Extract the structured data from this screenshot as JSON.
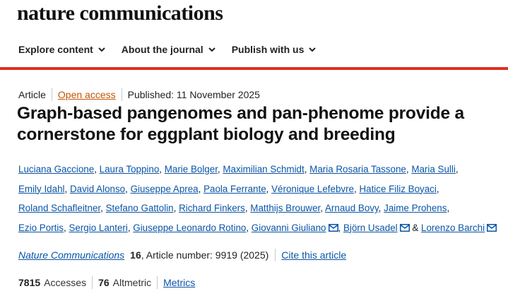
{
  "brand": "nature communications",
  "nav": [
    {
      "label": "Explore content"
    },
    {
      "label": "About the journal"
    },
    {
      "label": "Publish with us"
    }
  ],
  "meta": {
    "type": "Article",
    "access": "Open access",
    "published": "Published: 11 November 2025"
  },
  "title": "Graph-based pangenomes and pan-phenome provide a cornerstone for eggplant biology and breeding",
  "authors": [
    "Luciana Gaccione",
    "Laura Toppino",
    "Marie Bolger",
    "Maximilian Schmidt",
    "Maria Rosaria Tassone",
    "Maria Sulli",
    "Emily Idahl",
    "David Alonso",
    "Giuseppe Aprea",
    "Paola Ferrante",
    "Véronique Lefebvre",
    "Hatice Filiz Boyaci",
    "Roland Schafleitner",
    "Stefano Gattolin",
    "Richard Finkers",
    "Matthijs Brouwer",
    "Arnaud Bovy",
    "Jaime Prohens",
    "Ezio Portis",
    "Sergio Lanteri",
    "Giuseppe Leonardo Rotino",
    "Giovanni Giuliano",
    "Björn Usadel",
    "Lorenzo Barchi"
  ],
  "authors_and": "&",
  "citation": {
    "journal": "Nature Communications",
    "details": "16, Article number: 9919 (2025)",
    "volume": "16",
    "article_number": ", Article number: 9919 (2025)",
    "cite_link": "Cite this article"
  },
  "metrics": {
    "accesses_count": "7815",
    "accesses_label": "Accesses",
    "altmetric_count": "76",
    "altmetric_label": "Altmetric",
    "metrics_link": "Metrics"
  },
  "colors": {
    "accent_red": "#e0301e",
    "link_blue": "#0a55a6",
    "open_access_orange": "#c65301"
  },
  "icons": {
    "nav_chevron": "chevron-down-icon",
    "corresponding_author": "envelope-icon"
  }
}
